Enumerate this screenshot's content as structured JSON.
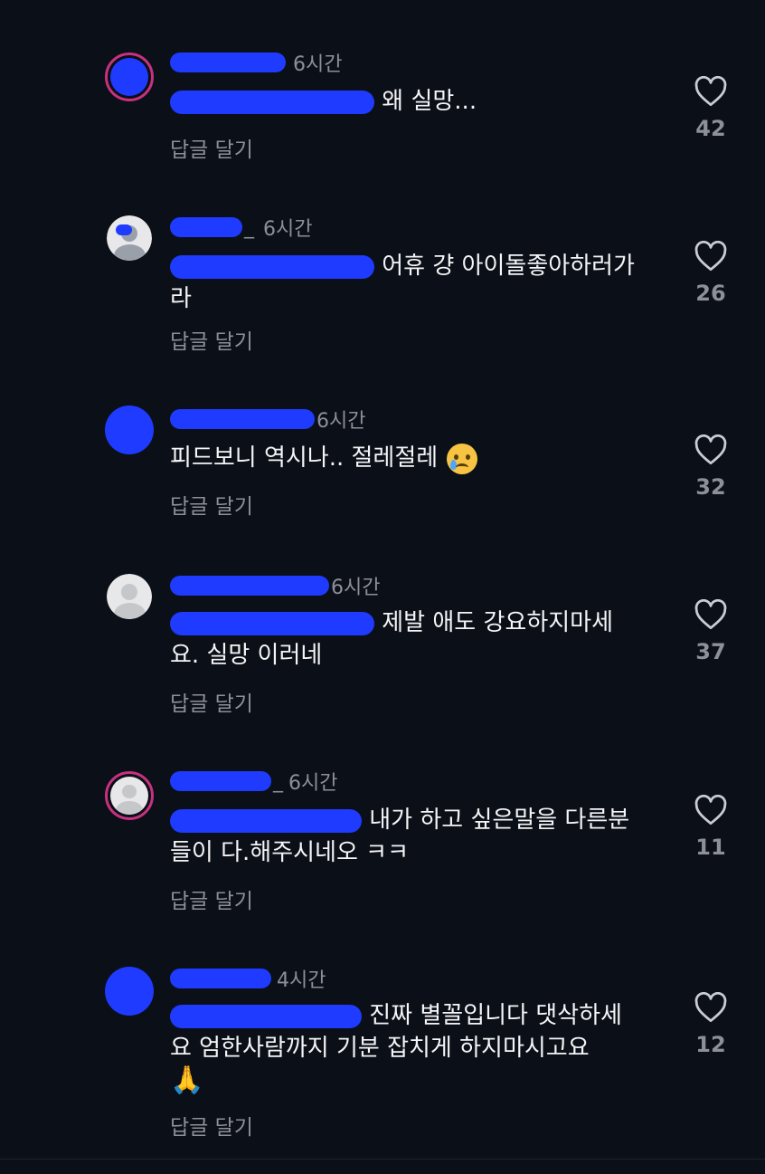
{
  "comments": [
    {
      "time": "6시간",
      "text": "왜 실망...",
      "reply": "답글 달기",
      "likes": "42",
      "avatar": "ring-blue"
    },
    {
      "time": "6시간",
      "text": "어휴 걍 아이돌좋아하러가\n라",
      "reply": "답글 달기",
      "likes": "26",
      "avatar": "default-person"
    },
    {
      "time": "6시간",
      "text": "피드보니 역시나.. 절레절레",
      "reply": "답글 달기",
      "likes": "32",
      "avatar": "blue"
    },
    {
      "time": "6시간",
      "text": "제발 애도 강요하지마세\n요. 실망 이러네",
      "reply": "답글 달기",
      "likes": "37",
      "avatar": "default-person"
    },
    {
      "time": "6시간",
      "text": "내가 하고 싶은말을 다른분\n들이 다.해주시네오 ㅋㅋ",
      "reply": "답글 달기",
      "likes": "11",
      "avatar": "ring-default"
    },
    {
      "time": "4시간",
      "text": "진짜 별꼴입니다 댓삭하세\n요 엄한사람까지 기분 잡치게 하지마시고요",
      "reply": "답글 달기",
      "likes": "12",
      "avatar": "blue"
    }
  ],
  "colors": {
    "background": "#0b0f17",
    "censor": "#1f3bff",
    "muted_text": "#8d9099",
    "story_ring": "#c8317f"
  },
  "icons": {
    "like": "heart-outline-icon",
    "emoji_3": "crying-face-emoji",
    "emoji_6": "folded-hands-emoji"
  }
}
